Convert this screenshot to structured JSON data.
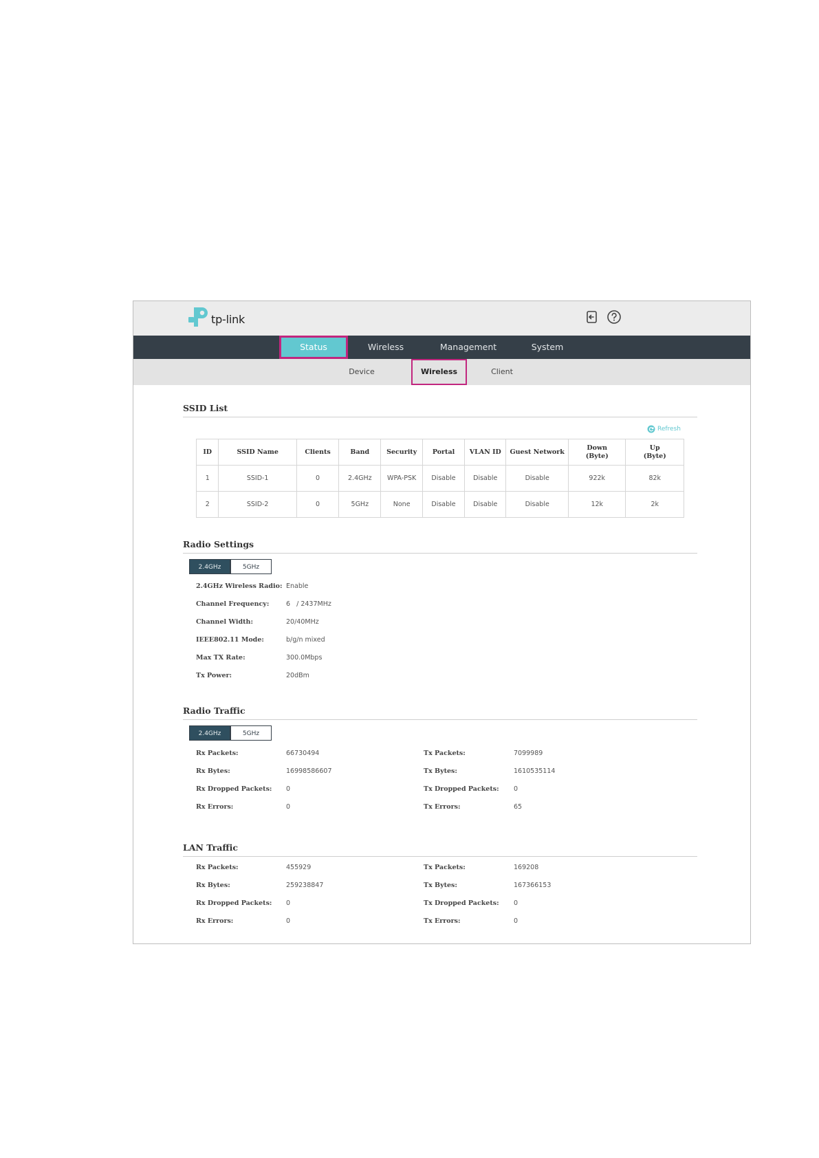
{
  "brand": {
    "logo_text": "tp-link"
  },
  "colors": {
    "accent": "#62c8d0",
    "nav_bg": "#353f48",
    "highlight": "#c1267e",
    "tab_active": "#2f4f5f"
  },
  "header_icons": [
    "logout-icon",
    "help-icon"
  ],
  "main_nav": [
    "Status",
    "Wireless",
    "Management",
    "System"
  ],
  "sub_nav": [
    "Device",
    "Wireless",
    "Client"
  ],
  "ssid_list": {
    "title": "SSID List",
    "refresh_label": "Refresh",
    "columns": [
      "ID",
      "SSID Name",
      "Clients",
      "Band",
      "Security",
      "Portal",
      "VLAN ID",
      "Guest Network",
      "Down\n(Byte)",
      "Up\n(Byte)"
    ],
    "rows": [
      [
        "1",
        "SSID-1",
        "0",
        "2.4GHz",
        "WPA-PSK",
        "Disable",
        "Disable",
        "Disable",
        "922k",
        "82k"
      ],
      [
        "2",
        "SSID-2",
        "0",
        "5GHz",
        "None",
        "Disable",
        "Disable",
        "Disable",
        "12k",
        "2k"
      ]
    ]
  },
  "radio_settings": {
    "title": "Radio Settings",
    "tabs": [
      "2.4GHz",
      "5GHz"
    ],
    "fields": [
      {
        "label": "2.4GHz Wireless Radio:",
        "value": "Enable"
      },
      {
        "label": "Channel Frequency:",
        "value": "6   / 2437MHz"
      },
      {
        "label": "Channel Width:",
        "value": "20/40MHz"
      },
      {
        "label": "IEEE802.11 Mode:",
        "value": "b/g/n mixed"
      },
      {
        "label": "Max TX Rate:",
        "value": "300.0Mbps"
      },
      {
        "label": "Tx Power:",
        "value": "20dBm"
      }
    ]
  },
  "radio_traffic": {
    "title": "Radio Traffic",
    "tabs": [
      "2.4GHz",
      "5GHz"
    ],
    "rx": [
      {
        "label": "Rx Packets:",
        "value": "66730494"
      },
      {
        "label": "Rx Bytes:",
        "value": "16998586607"
      },
      {
        "label": "Rx Dropped Packets:",
        "value": "0"
      },
      {
        "label": "Rx Errors:",
        "value": "0"
      }
    ],
    "tx": [
      {
        "label": "Tx Packets:",
        "value": "7099989"
      },
      {
        "label": "Tx Bytes:",
        "value": "1610535114"
      },
      {
        "label": "Tx Dropped Packets:",
        "value": "0"
      },
      {
        "label": "Tx Errors:",
        "value": "65"
      }
    ]
  },
  "lan_traffic": {
    "title": "LAN Traffic",
    "rx": [
      {
        "label": "Rx Packets:",
        "value": "455929"
      },
      {
        "label": "Rx Bytes:",
        "value": "259238847"
      },
      {
        "label": "Rx Dropped Packets:",
        "value": "0"
      },
      {
        "label": "Rx Errors:",
        "value": "0"
      }
    ],
    "tx": [
      {
        "label": "Tx Packets:",
        "value": "169208"
      },
      {
        "label": "Tx Bytes:",
        "value": "167366153"
      },
      {
        "label": "Tx Dropped Packets:",
        "value": "0"
      },
      {
        "label": "Tx Errors:",
        "value": "0"
      }
    ]
  }
}
